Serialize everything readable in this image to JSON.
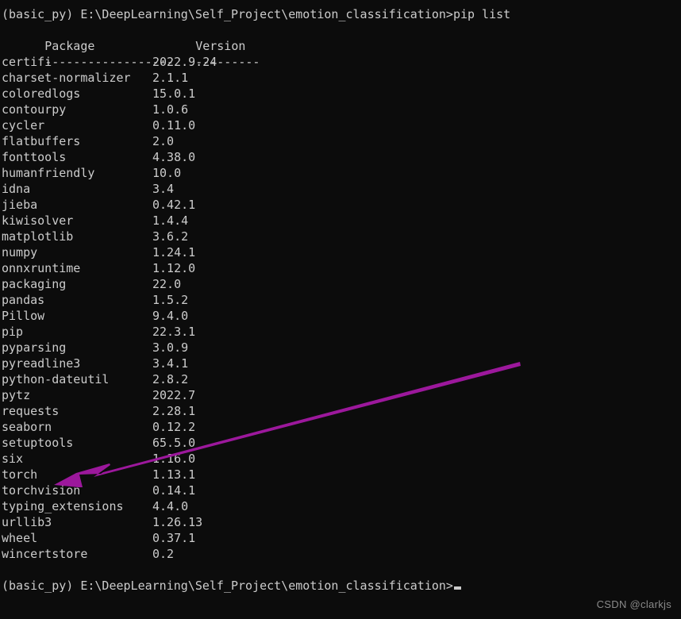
{
  "terminal": {
    "background_color": "#0c0c0c",
    "text_color": "#cccccc",
    "prompt_command_line": "(basic_py) E:\\DeepLearning\\Self_Project\\emotion_classification>pip list",
    "final_prompt_line": "(basic_py) E:\\DeepLearning\\Self_Project\\emotion_classification>",
    "header": {
      "package_label": "Package",
      "version_label": "Version",
      "package_rule": "------------------",
      "version_rule": "---------"
    },
    "packages": [
      {
        "name": "certifi",
        "version": "2022.9.24"
      },
      {
        "name": "charset-normalizer",
        "version": "2.1.1"
      },
      {
        "name": "coloredlogs",
        "version": "15.0.1"
      },
      {
        "name": "contourpy",
        "version": "1.0.6"
      },
      {
        "name": "cycler",
        "version": "0.11.0"
      },
      {
        "name": "flatbuffers",
        "version": "2.0"
      },
      {
        "name": "fonttools",
        "version": "4.38.0"
      },
      {
        "name": "humanfriendly",
        "version": "10.0"
      },
      {
        "name": "idna",
        "version": "3.4"
      },
      {
        "name": "jieba",
        "version": "0.42.1"
      },
      {
        "name": "kiwisolver",
        "version": "1.4.4"
      },
      {
        "name": "matplotlib",
        "version": "3.6.2"
      },
      {
        "name": "numpy",
        "version": "1.24.1"
      },
      {
        "name": "onnxruntime",
        "version": "1.12.0"
      },
      {
        "name": "packaging",
        "version": "22.0"
      },
      {
        "name": "pandas",
        "version": "1.5.2"
      },
      {
        "name": "Pillow",
        "version": "9.4.0"
      },
      {
        "name": "pip",
        "version": "22.3.1"
      },
      {
        "name": "pyparsing",
        "version": "3.0.9"
      },
      {
        "name": "pyreadline3",
        "version": "3.4.1"
      },
      {
        "name": "python-dateutil",
        "version": "2.8.2"
      },
      {
        "name": "pytz",
        "version": "2022.7"
      },
      {
        "name": "requests",
        "version": "2.28.1"
      },
      {
        "name": "seaborn",
        "version": "0.12.2"
      },
      {
        "name": "setuptools",
        "version": "65.5.0"
      },
      {
        "name": "six",
        "version": "1.16.0"
      },
      {
        "name": "torch",
        "version": "1.13.1"
      },
      {
        "name": "torchvision",
        "version": "0.14.1"
      },
      {
        "name": "typing_extensions",
        "version": "4.4.0"
      },
      {
        "name": "urllib3",
        "version": "1.26.13"
      },
      {
        "name": "wheel",
        "version": "0.37.1"
      },
      {
        "name": "wincertstore",
        "version": "0.2"
      }
    ]
  },
  "annotation": {
    "arrow_color": "#9c189c",
    "arrow_points_at": "torch"
  },
  "watermark": {
    "text": "CSDN @clarkjs"
  }
}
